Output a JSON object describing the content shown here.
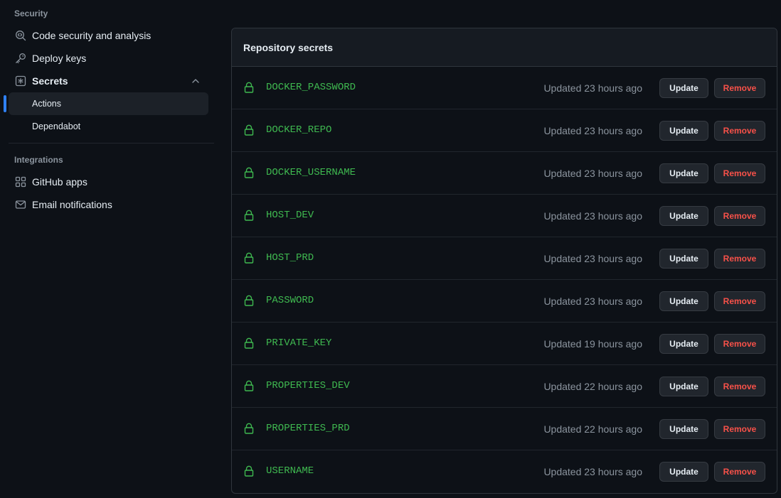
{
  "sidebar": {
    "security_heading": "Security",
    "items": [
      {
        "label": "Code security and analysis",
        "icon": "codescan-icon"
      },
      {
        "label": "Deploy keys",
        "icon": "key-icon"
      },
      {
        "label": "Secrets",
        "icon": "asterisk-icon"
      }
    ],
    "secrets_subitems": [
      {
        "label": "Actions",
        "active": true
      },
      {
        "label": "Dependabot",
        "active": false
      }
    ],
    "integrations_heading": "Integrations",
    "integrations": [
      {
        "label": "GitHub apps",
        "icon": "apps-icon"
      },
      {
        "label": "Email notifications",
        "icon": "mail-icon"
      }
    ]
  },
  "panel": {
    "title": "Repository secrets",
    "update_label": "Update",
    "remove_label": "Remove",
    "secrets": [
      {
        "name": "DOCKER_PASSWORD",
        "updated": "Updated 23 hours ago"
      },
      {
        "name": "DOCKER_REPO",
        "updated": "Updated 23 hours ago"
      },
      {
        "name": "DOCKER_USERNAME",
        "updated": "Updated 23 hours ago"
      },
      {
        "name": "HOST_DEV",
        "updated": "Updated 23 hours ago"
      },
      {
        "name": "HOST_PRD",
        "updated": "Updated 23 hours ago"
      },
      {
        "name": "PASSWORD",
        "updated": "Updated 23 hours ago"
      },
      {
        "name": "PRIVATE_KEY",
        "updated": "Updated 19 hours ago"
      },
      {
        "name": "PROPERTIES_DEV",
        "updated": "Updated 22 hours ago"
      },
      {
        "name": "PROPERTIES_PRD",
        "updated": "Updated 22 hours ago"
      },
      {
        "name": "USERNAME",
        "updated": "Updated 23 hours ago"
      }
    ]
  },
  "colors": {
    "accent": "#2f81f7",
    "secret_name": "#3fb950",
    "remove": "#f85149"
  }
}
